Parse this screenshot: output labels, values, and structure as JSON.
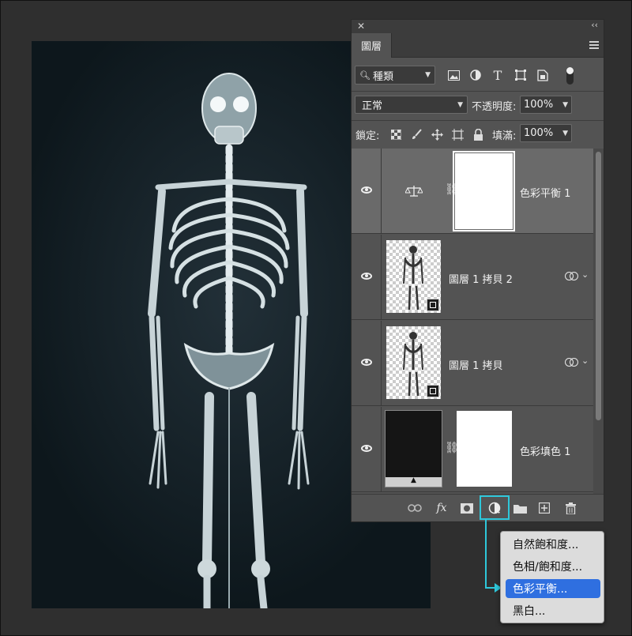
{
  "panel": {
    "tab_label": "圖層",
    "filter": {
      "label": "種類"
    },
    "blend_mode": "正常",
    "opacity_label": "不透明度:",
    "opacity_value": "100%",
    "lock_label": "鎖定:",
    "fill_label": "填滿:",
    "fill_value": "100%"
  },
  "layers": [
    {
      "name": "色彩平衡 1",
      "type": "adjustment",
      "selected": true
    },
    {
      "name": "圖層 1 拷貝 2",
      "type": "smart-object",
      "selected": false
    },
    {
      "name": "圖層 1 拷貝",
      "type": "smart-object",
      "selected": false
    },
    {
      "name": "色彩填色 1",
      "type": "fill",
      "selected": false
    }
  ],
  "bottom_bar": {
    "fx_label": "fx"
  },
  "adjustment_menu": {
    "items": [
      {
        "label": "自然飽和度...",
        "active": false
      },
      {
        "label": "色相/飽和度...",
        "active": false
      },
      {
        "label": "色彩平衡...",
        "active": true
      },
      {
        "label": "黑白...",
        "active": false
      }
    ]
  },
  "colors": {
    "highlight": "#2ec7da",
    "menu_active": "#2f6fe0",
    "panel_bg": "#535353",
    "canvas_bg": "#0f1a20"
  }
}
